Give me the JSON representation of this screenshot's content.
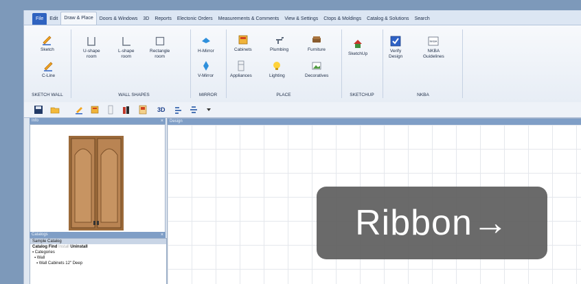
{
  "tabs": [
    {
      "label": "File",
      "style": "file"
    },
    {
      "label": "Edit",
      "style": ""
    },
    {
      "label": "Draw & Place",
      "style": "active"
    },
    {
      "label": "Doors & Windows",
      "style": ""
    },
    {
      "label": "3D",
      "style": ""
    },
    {
      "label": "Reports",
      "style": ""
    },
    {
      "label": "Electonic Orders",
      "style": ""
    },
    {
      "label": "Measurements & Comments",
      "style": ""
    },
    {
      "label": "View & Settings",
      "style": ""
    },
    {
      "label": "Ctops & Moldings",
      "style": ""
    },
    {
      "label": "Catalog & Solutions",
      "style": ""
    },
    {
      "label": "Search",
      "style": ""
    }
  ],
  "ribbon": {
    "sketch_wall": {
      "group": "SKETCH WALL",
      "sketch": "Sketch",
      "cline": "C-Line"
    },
    "wall_shapes": {
      "group": "WALL SHAPES",
      "ushape": [
        "U-shape",
        "room"
      ],
      "lshape": [
        "L-shape",
        "room"
      ],
      "rect": [
        "Rectangle",
        "room"
      ]
    },
    "mirror": {
      "group": "MIRROR",
      "h": "H-Mirror",
      "v": "V-Mirror"
    },
    "place": {
      "group": "PLACE",
      "cabinets": "Cabinets",
      "plumbing": "Plumbing",
      "furniture": "Furniture",
      "appliances": "Appliances",
      "lighting": "Lighting",
      "decoratives": "Decoratives"
    },
    "sketchup": {
      "group": "SKETCHUP",
      "btn": "SketchUp"
    },
    "nkba": {
      "group": "NKBA",
      "verify": [
        "Verify",
        "Design"
      ],
      "guidelines": [
        "NKBA",
        "Guidelines"
      ],
      "badge": "NKBA"
    }
  },
  "quick": {
    "threed": "3D"
  },
  "panels": {
    "info_title": "Info",
    "design_title": "Design",
    "catalogs_title": "Catalogs",
    "catalog_name": "Sample Catalog",
    "catalog_tabs": [
      "Catalog",
      "Find",
      "Install",
      "Uninstall"
    ],
    "tree": [
      "Categories",
      "Wall",
      "Wall Cabinets 12\" Deep"
    ]
  },
  "callout": {
    "text": "Ribbon→"
  }
}
